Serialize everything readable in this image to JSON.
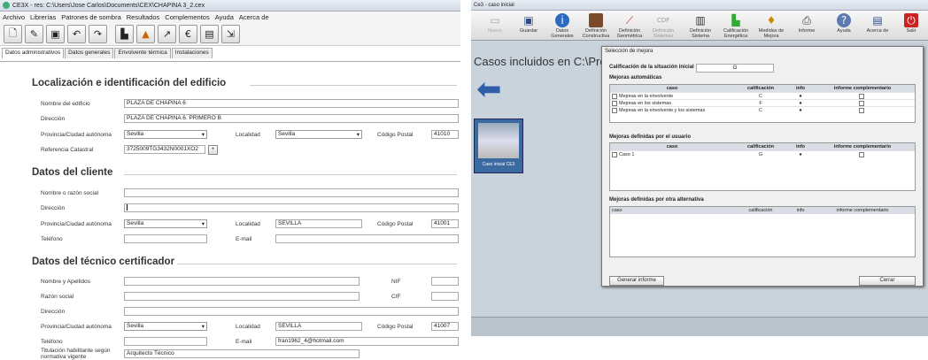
{
  "left": {
    "title": "CE3X - res: C:\\Users\\Jose Carlos\\Documents\\CEX\\CHAPINA 3_2.cex",
    "menu": [
      "Archivo",
      "Librerías",
      "Patrones de sombra",
      "Resultados",
      "Complementos",
      "Ayuda",
      "Acerca de"
    ],
    "tabs": [
      "Datos administrativos",
      "Datos generales",
      "Envolvente térmica",
      "Instalaciones"
    ],
    "sec1": "Localización e identificación del edificio",
    "sec2": "Datos del cliente",
    "sec3": "Datos del técnico certificador",
    "l_nombre_edificio": "Nombre del edificio",
    "v_nombre_edificio": "PLAZA DE CHAPINA 6",
    "l_direccion": "Dirección",
    "v_direccion": "PLAZA DE CHAPINA 6. PRIMERO B",
    "l_provincia": "Provincia/Ciudad autónoma",
    "v_provincia": "Sevilla",
    "l_localidad": "Localidad",
    "v_localidad": "Sevilla",
    "l_cp": "Código Postal",
    "v_cp": "41010",
    "l_refcat": "Referencia Catastral",
    "v_refcat": "3725009TG3432N0001XO2",
    "plus": "+",
    "l_razon_cliente": "Nombre o razón social",
    "l_dir_cliente": "Dirección",
    "l_prov_cliente": "Provincia/Ciudad autónoma",
    "v_prov_cliente": "Sevilla",
    "l_loc_cliente": "Localidad",
    "v_loc_cliente": "SEVILLA",
    "l_cp_cliente": "Código Postal",
    "v_cp_cliente": "41001",
    "l_tel_cliente": "Teléfono",
    "l_email_cliente": "E-mail",
    "l_nombre_tec": "Nombre y Apellidos",
    "l_nif": "NIF",
    "l_razon_tec": "Razón social",
    "l_cif": "CIF",
    "l_dir_tec": "Dirección",
    "l_prov_tec": "Provincia/Ciudad autónoma",
    "v_prov_tec": "Sevilla",
    "l_loc_tec": "Localidad",
    "v_loc_tec": "SEVILLA",
    "l_cp_tec": "Código Postal",
    "v_cp_tec": "41007",
    "l_tel_tec": "Teléfono",
    "l_email_tec": "E-mail",
    "v_email_tec": "fran1962_4@hotmail.com",
    "l_titulacion": "Titulación habilitante según normativa vigente",
    "v_titulacion": "Arquitecto Técnico"
  },
  "right": {
    "title": "Ce3 - caso inicial",
    "toolbar": [
      "Nuevo",
      "Guardar",
      "Datos Generales",
      "Definición Constructiva",
      "Definición Geométrica",
      "Definición Sistemas",
      "Definición Sistema",
      "Calificación Energética",
      "Medidas de Mejora",
      "Informe",
      "Ayuda",
      "Acerca de",
      "Salir"
    ],
    "cases_text": "Casos incluidos en C:\\Proyec",
    "case_label": "Caso inicial CE3",
    "dialog": {
      "title": "Selección de mejora",
      "calif_label": "Calificación de la situación inicial",
      "calif_value": "G",
      "auto_header": "Mejoras automáticas",
      "cols": [
        "caso",
        "calificación",
        "info",
        "informe complementario"
      ],
      "auto_rows": [
        [
          "Mejoras en la envolvente",
          "C"
        ],
        [
          "Mejoras en los sistemas",
          "F"
        ],
        [
          "Mejoras en la envolvente y los sistemas",
          "C"
        ]
      ],
      "user_header": "Mejoras definidas por el usuario",
      "user_rows": [
        [
          "Caso 1",
          "G"
        ]
      ],
      "alt_header": "Mejoras definidas por otra alternativa",
      "gen_btn": "Generar informe",
      "close_btn": "Cerrar"
    }
  }
}
